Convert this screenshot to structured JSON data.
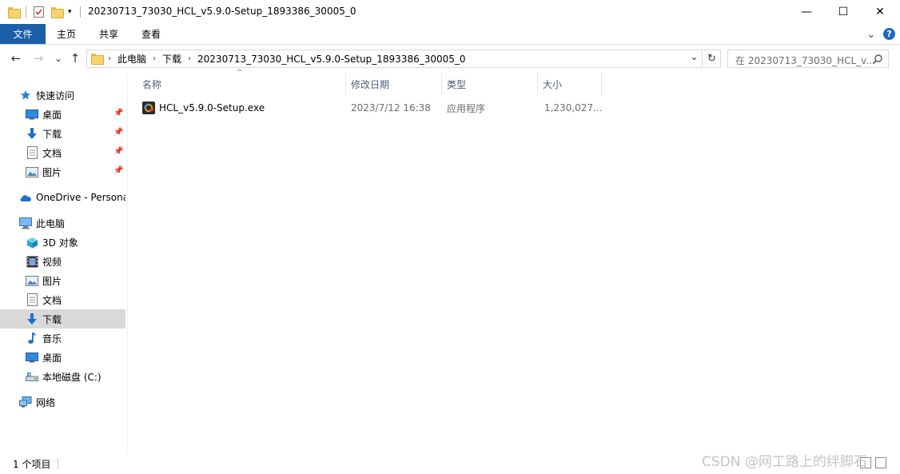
{
  "window": {
    "title": "20230713_73030_HCL_v5.9.0-Setup_1893386_30005_0",
    "minimize_glyph": "—",
    "maximize_glyph": "☐",
    "close_glyph": "✕"
  },
  "ribbon": {
    "tabs": [
      "文件",
      "主页",
      "共享",
      "查看"
    ],
    "expand_glyph": "⌄",
    "help_glyph": "?"
  },
  "address": {
    "crumbs": [
      "此电脑",
      "下载",
      "20230713_73030_HCL_v5.9.0-Setup_1893386_30005_0"
    ],
    "crumb_separator": "›",
    "dropdown_glyph": "⌄",
    "refresh_glyph": "↻"
  },
  "search": {
    "placeholder": "在 20230713_73030_HCL_v..."
  },
  "nav": {
    "back_glyph": "←",
    "forward_glyph": "→",
    "recent_glyph": "⌄",
    "up_glyph": "↑",
    "items": [
      {
        "label": "快速访问",
        "icon": "star-icon"
      },
      {
        "label": "桌面",
        "icon": "desktop-icon"
      },
      {
        "label": "下载",
        "icon": "download-icon"
      },
      {
        "label": "文档",
        "icon": "document-icon"
      },
      {
        "label": "图片",
        "icon": "picture-icon"
      },
      {
        "label": "OneDrive - Persona",
        "icon": "cloud-icon"
      },
      {
        "label": "此电脑",
        "icon": "computer-icon"
      },
      {
        "label": "3D 对象",
        "icon": "cube-icon"
      },
      {
        "label": "视频",
        "icon": "video-icon"
      },
      {
        "label": "图片",
        "icon": "picture-icon"
      },
      {
        "label": "文档",
        "icon": "document-icon"
      },
      {
        "label": "下载",
        "icon": "download-icon"
      },
      {
        "label": "音乐",
        "icon": "music-icon"
      },
      {
        "label": "桌面",
        "icon": "desktop-icon"
      },
      {
        "label": "本地磁盘 (C:)",
        "icon": "drive-icon"
      },
      {
        "label": "网络",
        "icon": "network-icon"
      }
    ]
  },
  "columns": {
    "name": "名称",
    "modified": "修改日期",
    "type": "类型",
    "size": "大小",
    "sort_glyph": "^"
  },
  "files": [
    {
      "name": "HCL_v5.9.0-Setup.exe",
      "modified": "2023/7/12 16:38",
      "type": "应用程序",
      "size": "1,230,027..."
    }
  ],
  "status": {
    "count": "1 个项目"
  },
  "watermark": "CSDN @网工路上的绊脚石",
  "colors": {
    "file_tab": "#1b5fa8",
    "selected_nav": "#d9d9d9",
    "header_text": "#4c607a",
    "meta_text": "#6d6d6d"
  }
}
